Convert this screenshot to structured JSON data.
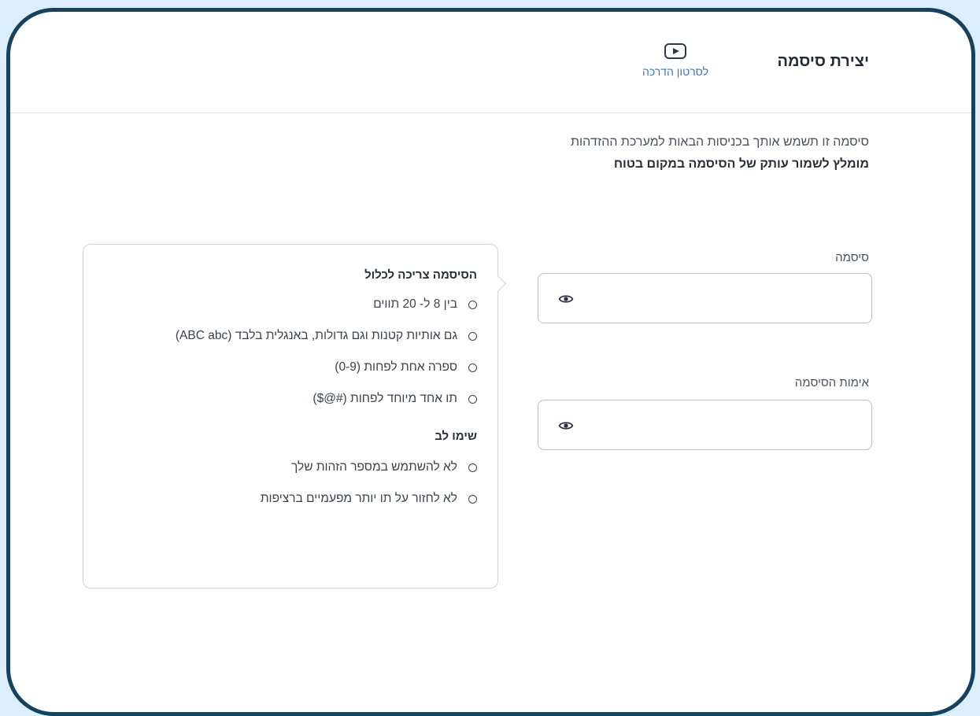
{
  "header": {
    "title": "יצירת סיסמה",
    "video_link_label": "לסרטון הדרכה",
    "video_icon": "play-icon"
  },
  "intro": {
    "line1": "סיסמה זו תשמש אותך בכניסות הבאות למערכת ההזדהות",
    "line2": "מומלץ לשמור עותק של הסיסמה במקום בטוח"
  },
  "form": {
    "password_label": "סיסמה",
    "password_value": "",
    "confirm_label": "אימות הסיסמה",
    "confirm_value": "",
    "toggle_icon": "eye-icon"
  },
  "rules": {
    "heading": "הסיסמה צריכה לכלול",
    "items": [
      "בין 8 ל- 20 תווים",
      "גם אותיות קטנות וגם גדולות, באנגלית בלבד (ABC abc)",
      "ספרה אחת לפחות (0-9)",
      "תו אחד מיוחד לפחות (#@$)"
    ],
    "note_heading": "שימו לב",
    "notes": [
      "לא להשתמש במספר הזהות שלך",
      "לא לחזור על תו יותר מפעמיים ברציפות"
    ]
  },
  "colors": {
    "frame": "#16425e",
    "background": "#dceefb",
    "link": "#3d78b6"
  }
}
